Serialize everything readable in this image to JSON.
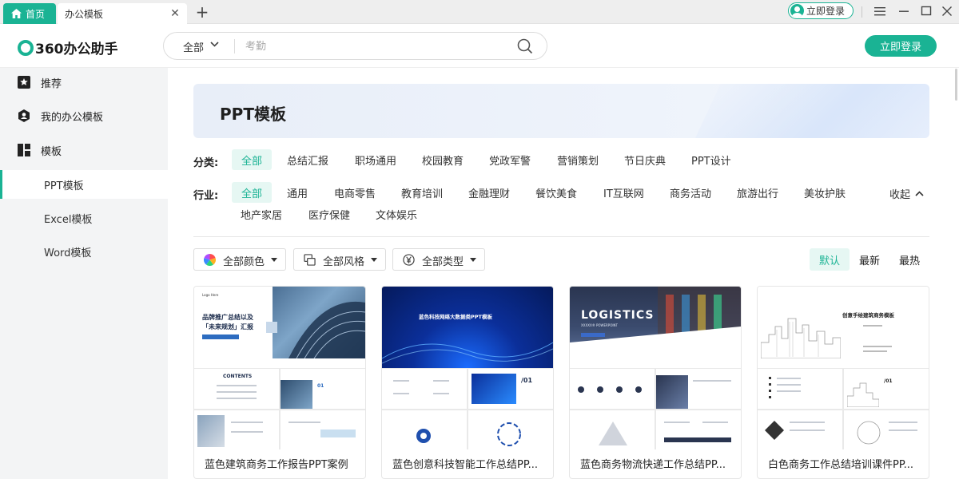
{
  "tabs": {
    "home": "首页",
    "active": "办公模板"
  },
  "titlebar": {
    "login_pill": "立即登录"
  },
  "header": {
    "logo": "360办公助手",
    "search_scope": "全部",
    "search_placeholder": "考勤",
    "login_button": "立即登录"
  },
  "sidebar": {
    "items": [
      {
        "label": "推荐"
      },
      {
        "label": "我的办公模板"
      },
      {
        "label": "模板"
      }
    ],
    "subitems": [
      {
        "label": "PPT模板"
      },
      {
        "label": "Excel模板"
      },
      {
        "label": "Word模板"
      }
    ]
  },
  "banner": {
    "title": "PPT模板"
  },
  "category": {
    "label": "分类:",
    "chips": [
      "全部",
      "总结汇报",
      "职场通用",
      "校园教育",
      "党政军警",
      "营销策划",
      "节日庆典",
      "PPT设计"
    ]
  },
  "industry": {
    "label": "行业:",
    "chips": [
      "全部",
      "通用",
      "电商零售",
      "教育培训",
      "金融理财",
      "餐饮美食",
      "IT互联网",
      "商务活动",
      "旅游出行",
      "美妆护肤",
      "地产家居",
      "医疗保健",
      "文体娱乐"
    ],
    "collapse": "收起"
  },
  "dropdowns": {
    "color": "全部颜色",
    "style": "全部风格",
    "type": "全部类型"
  },
  "sort": [
    "默认",
    "最新",
    "最热"
  ],
  "cards": [
    {
      "title": "蓝色建筑商务工作报告PPT案例",
      "thumb": {
        "logo": "Logo Here",
        "line1": "品牌推广总结以及",
        "line2": "「未来规划」汇报",
        "contents": "CONTENTS",
        "num": "01"
      }
    },
    {
      "title": "蓝色创意科技智能工作总结PP...",
      "thumb": {
        "heading": "蓝色科技网络大数据类PPT模板",
        "num": "/01"
      }
    },
    {
      "title": "蓝色商务物流快递工作总结PP...",
      "thumb": {
        "heading": "LOGISTICS",
        "sub": "XXXXX® POWERPOINT"
      }
    },
    {
      "title": "白色商务工作总结培训课件PP...",
      "thumb": {
        "heading": "创意手绘建筑商务模板",
        "num": "/01"
      }
    }
  ],
  "colors": {
    "accent": "#1ab394",
    "accent_light": "#e6f7f3"
  }
}
